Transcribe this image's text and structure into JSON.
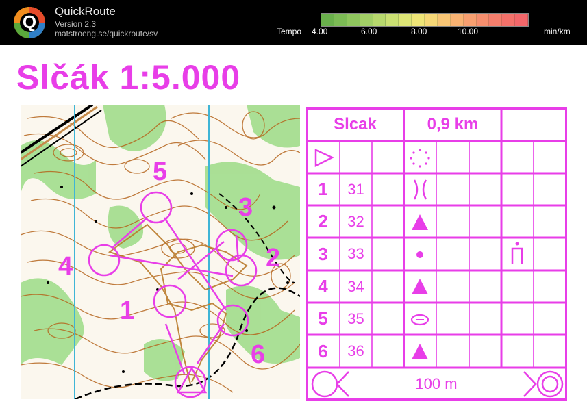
{
  "app": {
    "name": "QuickRoute",
    "version": "Version 2.3",
    "url": "matstroeng.se/quickroute/sv",
    "logo_letter": "Q"
  },
  "tempo": {
    "label": "Tempo",
    "ticks": [
      "4.00",
      "6.00",
      "8.00",
      "10.00"
    ],
    "unit": "min/km",
    "colors": [
      "#6ab04c",
      "#7cbb55",
      "#8fc65e",
      "#a2cf66",
      "#b7d86d",
      "#cbe073",
      "#dde576",
      "#eee577",
      "#f6d877",
      "#f8c575",
      "#f8b272",
      "#f79f70",
      "#f68e6e",
      "#f57e6c",
      "#f4716a",
      "#f3676a"
    ]
  },
  "map": {
    "title": "Slčák 1:5.000",
    "control_labels": [
      "1",
      "2",
      "3",
      "4",
      "5",
      "6"
    ],
    "colors": {
      "overprint": "#e83ee8",
      "north_line": "#3fb5d6",
      "contour": "#b5651d",
      "vegetation": "#7fd16b"
    }
  },
  "description": {
    "event_name": "Slcak",
    "distance": "0,9 km",
    "rows": [
      {
        "seq": "1",
        "code": "31",
        "symbol": "ravine-pair-icon"
      },
      {
        "seq": "2",
        "code": "32",
        "symbol": "boulder-triangle-icon"
      },
      {
        "seq": "3",
        "code": "33",
        "symbol": "knoll-dot-icon",
        "position": "foot-icon"
      },
      {
        "seq": "4",
        "code": "34",
        "symbol": "boulder-triangle-icon"
      },
      {
        "seq": "5",
        "code": "35",
        "symbol": "depression-ellipse-icon"
      },
      {
        "seq": "6",
        "code": "36",
        "symbol": "boulder-triangle-icon"
      }
    ],
    "finish_distance": "100 m"
  }
}
